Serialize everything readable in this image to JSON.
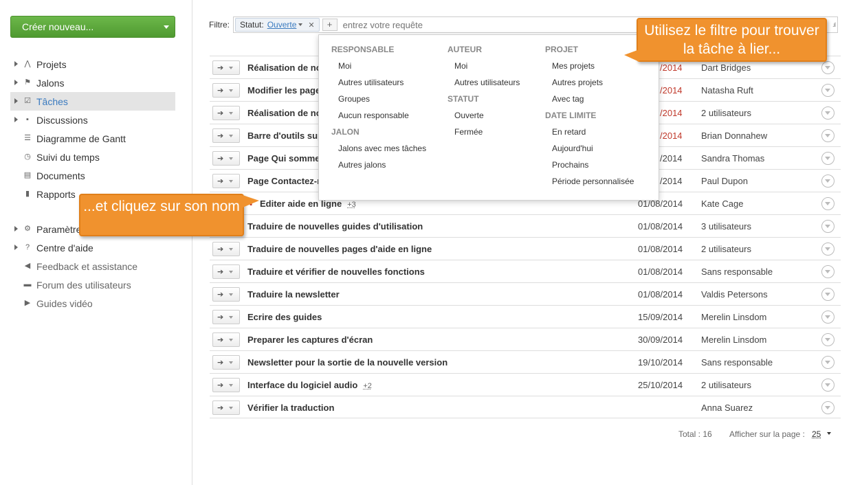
{
  "sidebar": {
    "create_button": "Créer nouveau...",
    "items": [
      {
        "label": "Projets",
        "icon": "projects-icon",
        "glyph": "⋀",
        "arrow": true
      },
      {
        "label": "Jalons",
        "icon": "flag-icon",
        "glyph": "⚑",
        "arrow": true
      },
      {
        "label": "Tâches",
        "icon": "checkbox-icon",
        "glyph": "☑",
        "arrow": true,
        "active": true
      },
      {
        "label": "Discussions",
        "icon": "chat-icon",
        "glyph": "▪",
        "arrow": true
      },
      {
        "label": "Diagramme de Gantt",
        "icon": "gantt-icon",
        "glyph": "☰",
        "arrow": false
      },
      {
        "label": "Suivi du temps",
        "icon": "clock-icon",
        "glyph": "◷",
        "arrow": false
      },
      {
        "label": "Documents",
        "icon": "document-icon",
        "glyph": "▤",
        "arrow": false
      },
      {
        "label": "Rapports",
        "icon": "bar-chart-icon",
        "glyph": "▮",
        "arrow": false
      }
    ],
    "items2": [
      {
        "label": "Paramètres",
        "icon": "gear-icon",
        "glyph": "⚙",
        "arrow": true
      },
      {
        "label": "Centre d'aide",
        "icon": "help-icon",
        "glyph": "?",
        "arrow": true
      },
      {
        "label": "Feedback et assistance",
        "icon": "megaphone-icon",
        "glyph": "◀",
        "arrow": false
      },
      {
        "label": "Forum des utilisateurs",
        "icon": "forum-icon",
        "glyph": "▬",
        "arrow": false
      },
      {
        "label": "Guides vidéo",
        "icon": "video-icon",
        "glyph": "▶",
        "arrow": false
      }
    ]
  },
  "filter": {
    "label": "Filtre:",
    "chip_key": "Statut:",
    "chip_value": "Ouverte",
    "placeholder": "entrez votre requête"
  },
  "dropdown": {
    "col1": [
      {
        "header": "RESPONSABLE",
        "items": [
          "Moi",
          "Autres utilisateurs",
          "Groupes",
          "Aucun responsable"
        ]
      },
      {
        "header": "JALON",
        "items": [
          "Jalons avec mes tâches",
          "Autres jalons"
        ]
      }
    ],
    "col2": [
      {
        "header": "AUTEUR",
        "items": [
          "Moi",
          "Autres utilisateurs"
        ]
      },
      {
        "header": "STATUT",
        "items": [
          "Ouverte",
          "Fermée"
        ]
      }
    ],
    "col3": [
      {
        "header": "PROJET",
        "items": [
          "Mes projets",
          "Autres projets",
          "Avec tag"
        ]
      },
      {
        "header": "DATE LIMITE",
        "items": [
          "En retard",
          "Aujourd'hui",
          "Prochains",
          "Période personnalisée"
        ]
      }
    ]
  },
  "tasks": [
    {
      "title": "Réalisation de no",
      "date": "/2014",
      "overdue": true,
      "responsible": "Dart Bridges"
    },
    {
      "title": "Modifier les page",
      "date": "/2014",
      "overdue": true,
      "responsible": "Natasha Ruft"
    },
    {
      "title": "Réalisation de no",
      "date": "/2014",
      "overdue": true,
      "responsible": "2 utilisateurs"
    },
    {
      "title": "Barre d'outils sup",
      "date": "/2014",
      "overdue": true,
      "responsible": "Brian Donnahew"
    },
    {
      "title": "Page Qui somme",
      "date": "/2014",
      "overdue": false,
      "responsible": "Sandra Thomas"
    },
    {
      "title": "Page Contactez-n",
      "date": "/2014",
      "overdue": false,
      "responsible": "Paul Dupon"
    },
    {
      "title": "Editer aide en ligne",
      "more": "+3",
      "priority": true,
      "noaction": true,
      "date": "01/08/2014",
      "overdue": false,
      "responsible": "Kate Cage"
    },
    {
      "title": "Traduire de nouvelles guides d'utilisation",
      "noaction": true,
      "date": "01/08/2014",
      "overdue": false,
      "responsible": "3 utilisateurs"
    },
    {
      "title": "Traduire de nouvelles pages d'aide en ligne",
      "date": "01/08/2014",
      "overdue": false,
      "responsible": "2 utilisateurs"
    },
    {
      "title": "Traduire et vérifier de nouvelles fonctions",
      "date": "01/08/2014",
      "overdue": false,
      "responsible": "Sans responsable"
    },
    {
      "title": "Traduire la newsletter",
      "date": "01/08/2014",
      "overdue": false,
      "responsible": "Valdis Petersons"
    },
    {
      "title": "Ecrire des guides",
      "date": "15/09/2014",
      "overdue": false,
      "responsible": "Merelin Linsdom"
    },
    {
      "title": "Preparer les captures d'écran",
      "date": "30/09/2014",
      "overdue": false,
      "responsible": "Merelin Linsdom"
    },
    {
      "title": "Newsletter pour la sortie de la nouvelle version",
      "date": "19/10/2014",
      "overdue": false,
      "responsible": "Sans responsable"
    },
    {
      "title": "Interface du logiciel audio",
      "more": "+2",
      "date": "25/10/2014",
      "overdue": false,
      "responsible": "2 utilisateurs"
    },
    {
      "title": "Vérifier la traduction",
      "date": "",
      "overdue": false,
      "responsible": "Anna Suarez"
    }
  ],
  "pager": {
    "total": "Total : 16",
    "per_page_label": "Afficher sur la page :",
    "per_page_value": "25"
  },
  "callouts": {
    "top": "Utilisez le filtre pour trouver la tâche à lier...",
    "left": "...et cliquez sur son nom"
  },
  "colors": {
    "accent": "#3a7abf",
    "overdue": "#c0392b",
    "create_button": "#5aa83a",
    "callout": "#f0922e"
  }
}
